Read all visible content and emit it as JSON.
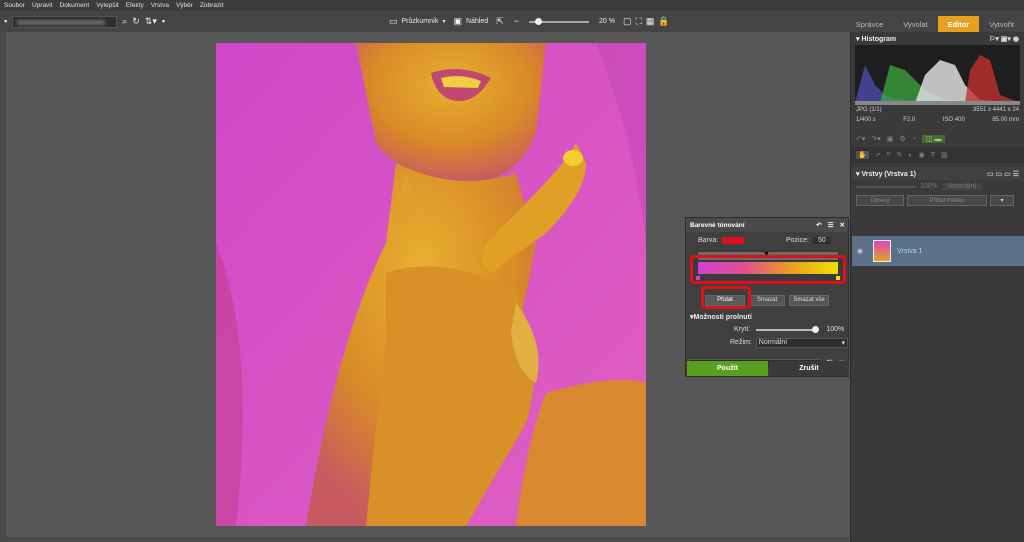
{
  "menu": [
    "Soubor",
    "Upravit",
    "Dokument",
    "Vylepšit",
    "Efekty",
    "Vrstva",
    "Výběr",
    "Zobrazit"
  ],
  "toolbar": {
    "explorer_label": "Průzkumník",
    "preview_label": "Náhled",
    "zoom": "20 %"
  },
  "modes": [
    "Správce",
    "Vyvolat",
    "Editor",
    "Vytvořit"
  ],
  "histogram": {
    "title": "Histogram",
    "format": "JPG",
    "count": "(1/1)",
    "dimensions": "3551 x 4441 x 24",
    "shutter": "1/400 s",
    "aperture": "F2.0",
    "iso": "ISO 400",
    "focal": "85.00 mm"
  },
  "layers": {
    "title": "Vrstvy (Vrstva 1)",
    "opacity": "100%",
    "mode": "Normální",
    "adjust_label": "Úpravy",
    "add_mask_label": "Přidat masku",
    "layer_name": "Vrstva 1"
  },
  "dialog": {
    "title": "Barevné tónování",
    "color_label": "Barva:",
    "position_label": "Pozice:",
    "position_value": "50",
    "add_button": "Přidat",
    "delete_button": "Smazat",
    "delete_all_button": "Smazat vše",
    "blend_section": "Možnosti prolnutí",
    "opacity_label": "Krytí:",
    "opacity_value": "100%",
    "mode_label": "Režim:",
    "mode_value": "Normální",
    "apply_button": "Použít",
    "cancel_button": "Zrušit"
  },
  "colors": {
    "accent": "#e8a020",
    "apply_green": "#5aa020",
    "highlight_red": "#e0101a",
    "layer_selected": "#5b7089",
    "gradient": [
      "#d040d0",
      "#e05090",
      "#e8a020",
      "#f0e000"
    ]
  }
}
